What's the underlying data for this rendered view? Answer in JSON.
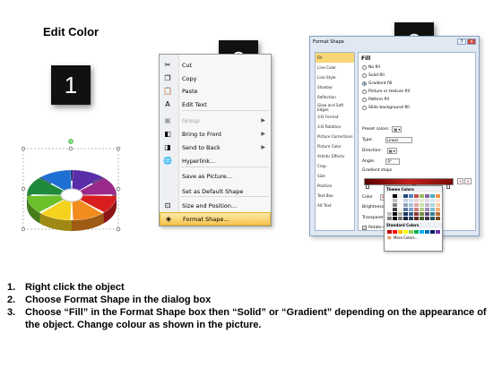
{
  "title": "Edit Color",
  "badges": [
    "1",
    "2",
    "3"
  ],
  "context_menu": {
    "items": [
      {
        "label": "Cut",
        "icon": "scissors-icon",
        "glyph": "✂",
        "disabled": false,
        "arrow": false
      },
      {
        "label": "Copy",
        "icon": "copy-icon",
        "glyph": "❐",
        "disabled": false,
        "arrow": false
      },
      {
        "label": "Paste",
        "icon": "paste-icon",
        "glyph": "📋",
        "disabled": false,
        "arrow": false
      },
      {
        "label": "Edit Text",
        "icon": "edit-text-icon",
        "glyph": "A",
        "disabled": false,
        "arrow": false
      },
      {
        "label": "Group",
        "icon": "group-icon",
        "glyph": "▣",
        "disabled": true,
        "arrow": true
      },
      {
        "label": "Bring to Front",
        "icon": "bring-to-front-icon",
        "glyph": "◧",
        "disabled": false,
        "arrow": true
      },
      {
        "label": "Send to Back",
        "icon": "send-to-back-icon",
        "glyph": "◨",
        "disabled": false,
        "arrow": true
      },
      {
        "label": "Hyperlink...",
        "icon": "hyperlink-icon",
        "glyph": "🌐",
        "disabled": false,
        "arrow": false
      },
      {
        "label": "Save as Picture...",
        "icon": "",
        "glyph": "",
        "disabled": false,
        "arrow": false
      },
      {
        "label": "Set as Default Shape",
        "icon": "",
        "glyph": "",
        "disabled": false,
        "arrow": false
      },
      {
        "label": "Size and Position...",
        "icon": "size-position-icon",
        "glyph": "⊡",
        "disabled": false,
        "arrow": false
      },
      {
        "label": "Format Shape...",
        "icon": "format-shape-icon",
        "glyph": "◈",
        "disabled": false,
        "arrow": false,
        "highlight": true
      }
    ]
  },
  "dialog": {
    "title": "Format Shape",
    "sidebar": [
      "Fill",
      "Line Color",
      "Line Style",
      "Shadow",
      "Reflection",
      "Glow and Soft Edges",
      "3-D Format",
      "3-D Rotation",
      "Picture Corrections",
      "Picture Color",
      "Artistic Effects",
      "Crop",
      "Size",
      "Position",
      "Text Box",
      "Alt Text"
    ],
    "fill_header": "Fill",
    "options": [
      {
        "label": "No fill",
        "on": false
      },
      {
        "label": "Solid fill",
        "on": false
      },
      {
        "label": "Gradient fill",
        "on": true
      },
      {
        "label": "Picture or texture fill",
        "on": false
      },
      {
        "label": "Pattern fill",
        "on": false
      },
      {
        "label": "Slide background fill",
        "on": false
      }
    ],
    "preset_label": "Preset colors:",
    "type_label": "Type:",
    "type_value": "Linear",
    "direction_label": "Direction:",
    "angle_label": "Angle:",
    "angle_value": "0°",
    "stops_label": "Gradient stops",
    "color_label": "Color",
    "position_label": "Position:",
    "position_value": "0%",
    "brightness_label": "Brightness",
    "transparency_label": "Transparency",
    "rotate_label": "Rotate with shape"
  },
  "picker": {
    "theme_label": "Theme Colors",
    "standard_label": "Standard Colors",
    "more_label": "More Colors...",
    "theme_top": [
      "#ffffff",
      "#000000",
      "#eeece1",
      "#1f497d",
      "#4f81bd",
      "#c0504d",
      "#9bbb59",
      "#8064a2",
      "#4bacc6",
      "#f79646"
    ],
    "standard": [
      "#c00000",
      "#ff0000",
      "#ffc000",
      "#ffff00",
      "#92d050",
      "#00b050",
      "#00b0f0",
      "#0070c0",
      "#002060",
      "#7030a0"
    ]
  },
  "pie": {
    "segments": [
      "#d81e1e",
      "#f28c1e",
      "#f5d21e",
      "#6cc02a",
      "#1f8a3c",
      "#1e6fd1",
      "#5a2ea8",
      "#9a2a8a"
    ]
  },
  "instructions": [
    {
      "num": "1.",
      "text": "Right click the object"
    },
    {
      "num": "2.",
      "text": "Choose Format Shape in the dialog box"
    },
    {
      "num": "3.",
      "text": "Choose “Fill” in the Format Shape box then “Solid” or “Gradient” depending on the appearance of the object. Change colour as shown in the picture."
    }
  ]
}
